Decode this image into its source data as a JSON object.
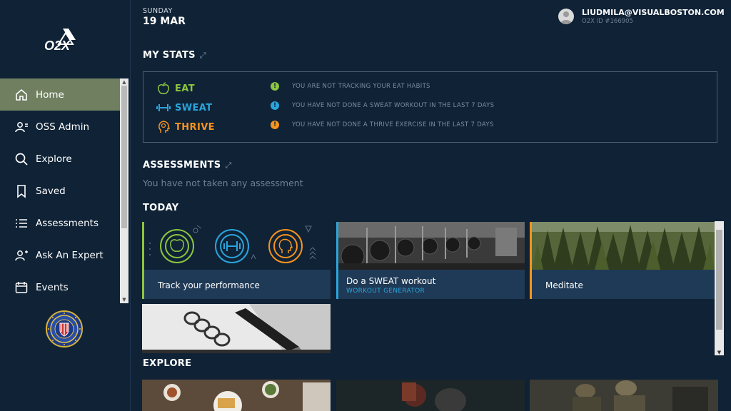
{
  "sidebar": {
    "items": [
      {
        "label": "Home",
        "icon": "home-icon"
      },
      {
        "label": "OSS Admin",
        "icon": "user-admin-icon"
      },
      {
        "label": "Explore",
        "icon": "search-icon"
      },
      {
        "label": "Saved",
        "icon": "bookmark-icon"
      },
      {
        "label": "Assessments",
        "icon": "list-icon"
      },
      {
        "label": "Ask An Expert",
        "icon": "user-question-icon"
      },
      {
        "label": "Events",
        "icon": "calendar-icon"
      }
    ],
    "active_color": "#6f7f60",
    "logo_text": "O2X"
  },
  "header": {
    "day": "SUNDAY",
    "date": "19 MAR",
    "email": "LIUDMILA@VISUALBOSTON.COM",
    "user_id": "O2X ID #166905"
  },
  "stats": {
    "title": "MY STATS",
    "rows": [
      {
        "label": "EAT",
        "color": "#8cc63f",
        "message": "YOU ARE NOT TRACKING YOUR EAT HABITS"
      },
      {
        "label": "SWEAT",
        "color": "#2aa5dc",
        "message": "YOU HAVE NOT DONE A SWEAT WORKOUT IN THE LAST 7 DAYS"
      },
      {
        "label": "THRIVE",
        "color": "#f7941d",
        "message": "YOU HAVE NOT DONE A THRIVE EXERCISE IN THE LAST 7 DAYS"
      }
    ]
  },
  "assessments": {
    "title": "ASSESSMENTS",
    "empty_message": "You have not taken any assessment"
  },
  "today": {
    "title": "TODAY",
    "cards": [
      {
        "label": "Track your performance",
        "accent": "#8cc63f"
      },
      {
        "label": "Do a SWEAT workout",
        "sublabel": "WORKOUT GENERATOR",
        "accent": "#2aa5dc"
      },
      {
        "label": "Meditate",
        "accent": "#f7941d"
      }
    ]
  },
  "explore": {
    "title": "EXPLORE"
  }
}
